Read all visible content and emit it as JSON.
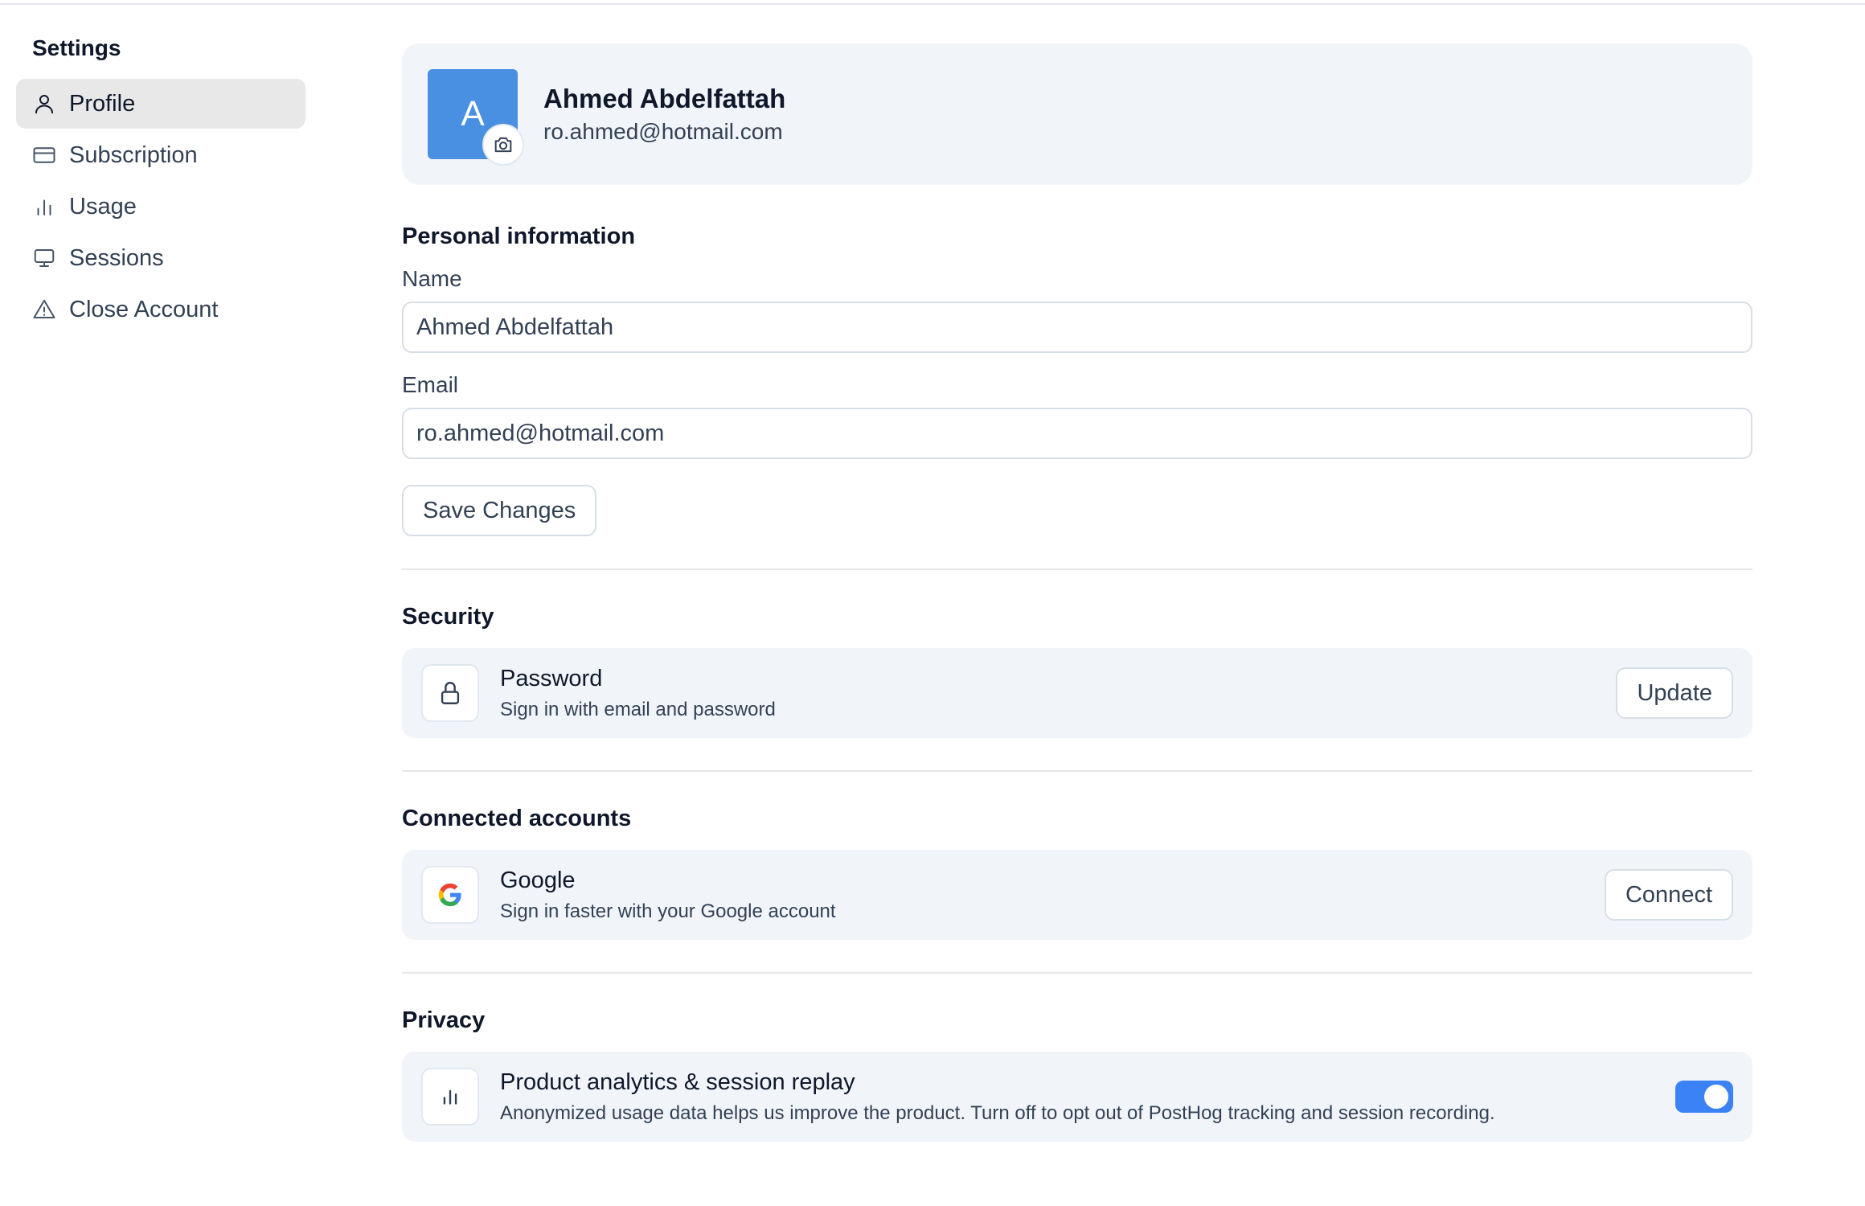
{
  "sidebar": {
    "title": "Settings",
    "items": [
      {
        "label": "Profile",
        "icon": "user-icon",
        "active": true
      },
      {
        "label": "Subscription",
        "icon": "credit-card-icon",
        "active": false
      },
      {
        "label": "Usage",
        "icon": "bar-chart-icon",
        "active": false
      },
      {
        "label": "Sessions",
        "icon": "monitor-icon",
        "active": false
      },
      {
        "label": "Close Account",
        "icon": "warning-triangle-icon",
        "active": false
      }
    ]
  },
  "profile": {
    "avatar_initial": "A",
    "name": "Ahmed Abdelfattah",
    "email": "ro.ahmed@hotmail.com"
  },
  "personal": {
    "title": "Personal information",
    "name_label": "Name",
    "name_value": "Ahmed Abdelfattah",
    "email_label": "Email",
    "email_value": "ro.ahmed@hotmail.com",
    "save_label": "Save Changes"
  },
  "security": {
    "title": "Security",
    "password_title": "Password",
    "password_sub": "Sign in with email and password",
    "update_label": "Update"
  },
  "connected": {
    "title": "Connected accounts",
    "google_title": "Google",
    "google_sub": "Sign in faster with your Google account",
    "connect_label": "Connect"
  },
  "privacy": {
    "title": "Privacy",
    "analytics_title": "Product analytics & session replay",
    "analytics_sub": "Anonymized usage data helps us improve the product. Turn off to opt out of PostHog tracking and session recording.",
    "toggle_on": true
  },
  "colors": {
    "accent": "#3b82f6",
    "avatar_bg": "#4a90e2",
    "card_bg": "#f1f5f9",
    "active_nav_bg": "#e8e8e8"
  }
}
